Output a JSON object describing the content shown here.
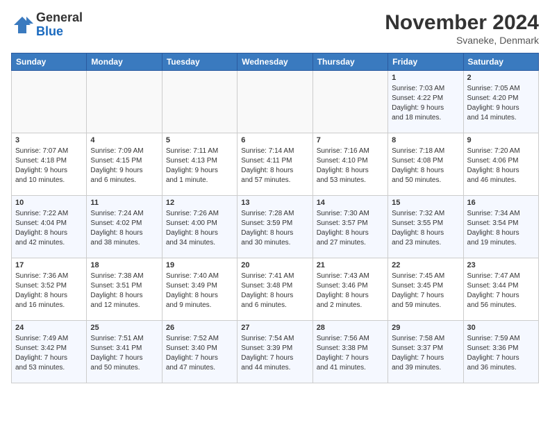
{
  "logo": {
    "text_general": "General",
    "text_blue": "Blue"
  },
  "header": {
    "month_year": "November 2024",
    "location": "Svaneke, Denmark"
  },
  "weekdays": [
    "Sunday",
    "Monday",
    "Tuesday",
    "Wednesday",
    "Thursday",
    "Friday",
    "Saturday"
  ],
  "weeks": [
    [
      {
        "day": "",
        "info": ""
      },
      {
        "day": "",
        "info": ""
      },
      {
        "day": "",
        "info": ""
      },
      {
        "day": "",
        "info": ""
      },
      {
        "day": "",
        "info": ""
      },
      {
        "day": "1",
        "info": "Sunrise: 7:03 AM\nSunset: 4:22 PM\nDaylight: 9 hours\nand 18 minutes."
      },
      {
        "day": "2",
        "info": "Sunrise: 7:05 AM\nSunset: 4:20 PM\nDaylight: 9 hours\nand 14 minutes."
      }
    ],
    [
      {
        "day": "3",
        "info": "Sunrise: 7:07 AM\nSunset: 4:18 PM\nDaylight: 9 hours\nand 10 minutes."
      },
      {
        "day": "4",
        "info": "Sunrise: 7:09 AM\nSunset: 4:15 PM\nDaylight: 9 hours\nand 6 minutes."
      },
      {
        "day": "5",
        "info": "Sunrise: 7:11 AM\nSunset: 4:13 PM\nDaylight: 9 hours\nand 1 minute."
      },
      {
        "day": "6",
        "info": "Sunrise: 7:14 AM\nSunset: 4:11 PM\nDaylight: 8 hours\nand 57 minutes."
      },
      {
        "day": "7",
        "info": "Sunrise: 7:16 AM\nSunset: 4:10 PM\nDaylight: 8 hours\nand 53 minutes."
      },
      {
        "day": "8",
        "info": "Sunrise: 7:18 AM\nSunset: 4:08 PM\nDaylight: 8 hours\nand 50 minutes."
      },
      {
        "day": "9",
        "info": "Sunrise: 7:20 AM\nSunset: 4:06 PM\nDaylight: 8 hours\nand 46 minutes."
      }
    ],
    [
      {
        "day": "10",
        "info": "Sunrise: 7:22 AM\nSunset: 4:04 PM\nDaylight: 8 hours\nand 42 minutes."
      },
      {
        "day": "11",
        "info": "Sunrise: 7:24 AM\nSunset: 4:02 PM\nDaylight: 8 hours\nand 38 minutes."
      },
      {
        "day": "12",
        "info": "Sunrise: 7:26 AM\nSunset: 4:00 PM\nDaylight: 8 hours\nand 34 minutes."
      },
      {
        "day": "13",
        "info": "Sunrise: 7:28 AM\nSunset: 3:59 PM\nDaylight: 8 hours\nand 30 minutes."
      },
      {
        "day": "14",
        "info": "Sunrise: 7:30 AM\nSunset: 3:57 PM\nDaylight: 8 hours\nand 27 minutes."
      },
      {
        "day": "15",
        "info": "Sunrise: 7:32 AM\nSunset: 3:55 PM\nDaylight: 8 hours\nand 23 minutes."
      },
      {
        "day": "16",
        "info": "Sunrise: 7:34 AM\nSunset: 3:54 PM\nDaylight: 8 hours\nand 19 minutes."
      }
    ],
    [
      {
        "day": "17",
        "info": "Sunrise: 7:36 AM\nSunset: 3:52 PM\nDaylight: 8 hours\nand 16 minutes."
      },
      {
        "day": "18",
        "info": "Sunrise: 7:38 AM\nSunset: 3:51 PM\nDaylight: 8 hours\nand 12 minutes."
      },
      {
        "day": "19",
        "info": "Sunrise: 7:40 AM\nSunset: 3:49 PM\nDaylight: 8 hours\nand 9 minutes."
      },
      {
        "day": "20",
        "info": "Sunrise: 7:41 AM\nSunset: 3:48 PM\nDaylight: 8 hours\nand 6 minutes."
      },
      {
        "day": "21",
        "info": "Sunrise: 7:43 AM\nSunset: 3:46 PM\nDaylight: 8 hours\nand 2 minutes."
      },
      {
        "day": "22",
        "info": "Sunrise: 7:45 AM\nSunset: 3:45 PM\nDaylight: 7 hours\nand 59 minutes."
      },
      {
        "day": "23",
        "info": "Sunrise: 7:47 AM\nSunset: 3:44 PM\nDaylight: 7 hours\nand 56 minutes."
      }
    ],
    [
      {
        "day": "24",
        "info": "Sunrise: 7:49 AM\nSunset: 3:42 PM\nDaylight: 7 hours\nand 53 minutes."
      },
      {
        "day": "25",
        "info": "Sunrise: 7:51 AM\nSunset: 3:41 PM\nDaylight: 7 hours\nand 50 minutes."
      },
      {
        "day": "26",
        "info": "Sunrise: 7:52 AM\nSunset: 3:40 PM\nDaylight: 7 hours\nand 47 minutes."
      },
      {
        "day": "27",
        "info": "Sunrise: 7:54 AM\nSunset: 3:39 PM\nDaylight: 7 hours\nand 44 minutes."
      },
      {
        "day": "28",
        "info": "Sunrise: 7:56 AM\nSunset: 3:38 PM\nDaylight: 7 hours\nand 41 minutes."
      },
      {
        "day": "29",
        "info": "Sunrise: 7:58 AM\nSunset: 3:37 PM\nDaylight: 7 hours\nand 39 minutes."
      },
      {
        "day": "30",
        "info": "Sunrise: 7:59 AM\nSunset: 3:36 PM\nDaylight: 7 hours\nand 36 minutes."
      }
    ]
  ]
}
